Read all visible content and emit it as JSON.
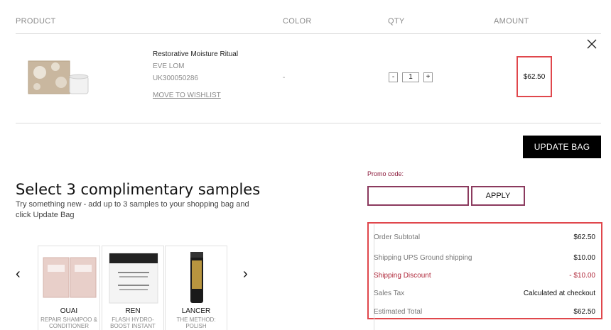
{
  "table_headers": {
    "product": "PRODUCT",
    "color": "COLOR",
    "qty": "QTY",
    "amount": "AMOUNT"
  },
  "item": {
    "name": "Restorative Moisture Ritual",
    "brand": "EVE LOM",
    "sku": "UK300050286",
    "wishlist_label": "MOVE TO WISHLIST",
    "color": "-",
    "qty_minus": "-",
    "qty": "1",
    "qty_plus": "+",
    "amount": "$62.50"
  },
  "update_bag_label": "UPDATE BAG",
  "promo": {
    "label": "Promo code:",
    "placeholder": "",
    "apply_label": "APPLY"
  },
  "samples": {
    "title": "Select 3 complimentary samples",
    "subtitle": "Try something new - add up to 3 samples to your shopping bag and click Update Bag",
    "prev": "‹",
    "next": "›",
    "items": [
      {
        "brand": "OUAI",
        "name": "REPAIR SHAMPOO & CONDITIONER"
      },
      {
        "brand": "REN",
        "name": "FLASH HYDRO-BOOST INSTANT"
      },
      {
        "brand": "LANCER",
        "name": "THE METHOD: POLISH"
      }
    ]
  },
  "summary": {
    "subtotal_label": "Order Subtotal",
    "subtotal": "$62.50",
    "shipping_label": "Shipping UPS Ground shipping",
    "shipping": "$10.00",
    "discount_label": "Shipping Discount",
    "discount": "- $10.00",
    "tax_label": "Sales Tax",
    "tax": "Calculated at checkout",
    "total_label": "Estimated Total",
    "total": "$62.50"
  },
  "colors": {
    "highlight": "#e0474c",
    "promo_accent": "#8b1a3b",
    "button_bg": "#000000"
  }
}
